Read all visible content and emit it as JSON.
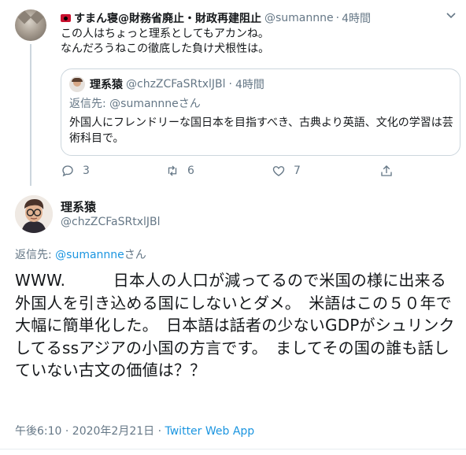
{
  "reply_tweet": {
    "display_name": "すまん寝@財務省廃止・財政再建阻止",
    "handle": "@sumannne",
    "separator": "·",
    "time": "4時間",
    "lines": [
      "この人はちょっと理系としてもアカンね。",
      "なんだろうねこの徹底した負け犬根性は。"
    ],
    "quoted": {
      "display_name": "理系猿",
      "handle": "@chzZCFaSRtxlJBl",
      "separator": "·",
      "time": "4時間",
      "reply_prefix": "返信先: ",
      "reply_to": "@sumannne",
      "reply_suffix": "さん",
      "text": "外国人にフレンドリーな国日本を目指すべき、古典より英語、文化の学習は芸術科目で。"
    },
    "actions": {
      "reply_count": "3",
      "retweet_count": "6",
      "like_count": "7"
    }
  },
  "main_tweet": {
    "display_name": "理系猿",
    "handle": "@chzZCFaSRtxlJBl",
    "reply_prefix": "返信先: ",
    "reply_to": "@sumannne",
    "reply_suffix": "さん",
    "text": "WWW.　　　日本人の人口が減ってるので米国の様に出来る外国人を引き込める国にしないとダメ。　米語はこの５０年で大幅に簡単化した。　日本語は話者の少ないGDPがシュリンクしてるssアジアの小国の方言です。　ましてその国の誰も話していない古文の価値は？？",
    "timestamp": "午後6:10 · 2020年2月21日 · ",
    "source": "Twitter Web App"
  },
  "icons": [
    "caret-down-icon",
    "reply-icon",
    "retweet-icon",
    "like-icon",
    "share-icon"
  ],
  "colors": {
    "link": "#1b95e0",
    "secondary": "#657786",
    "border": "#ccd6dd"
  }
}
